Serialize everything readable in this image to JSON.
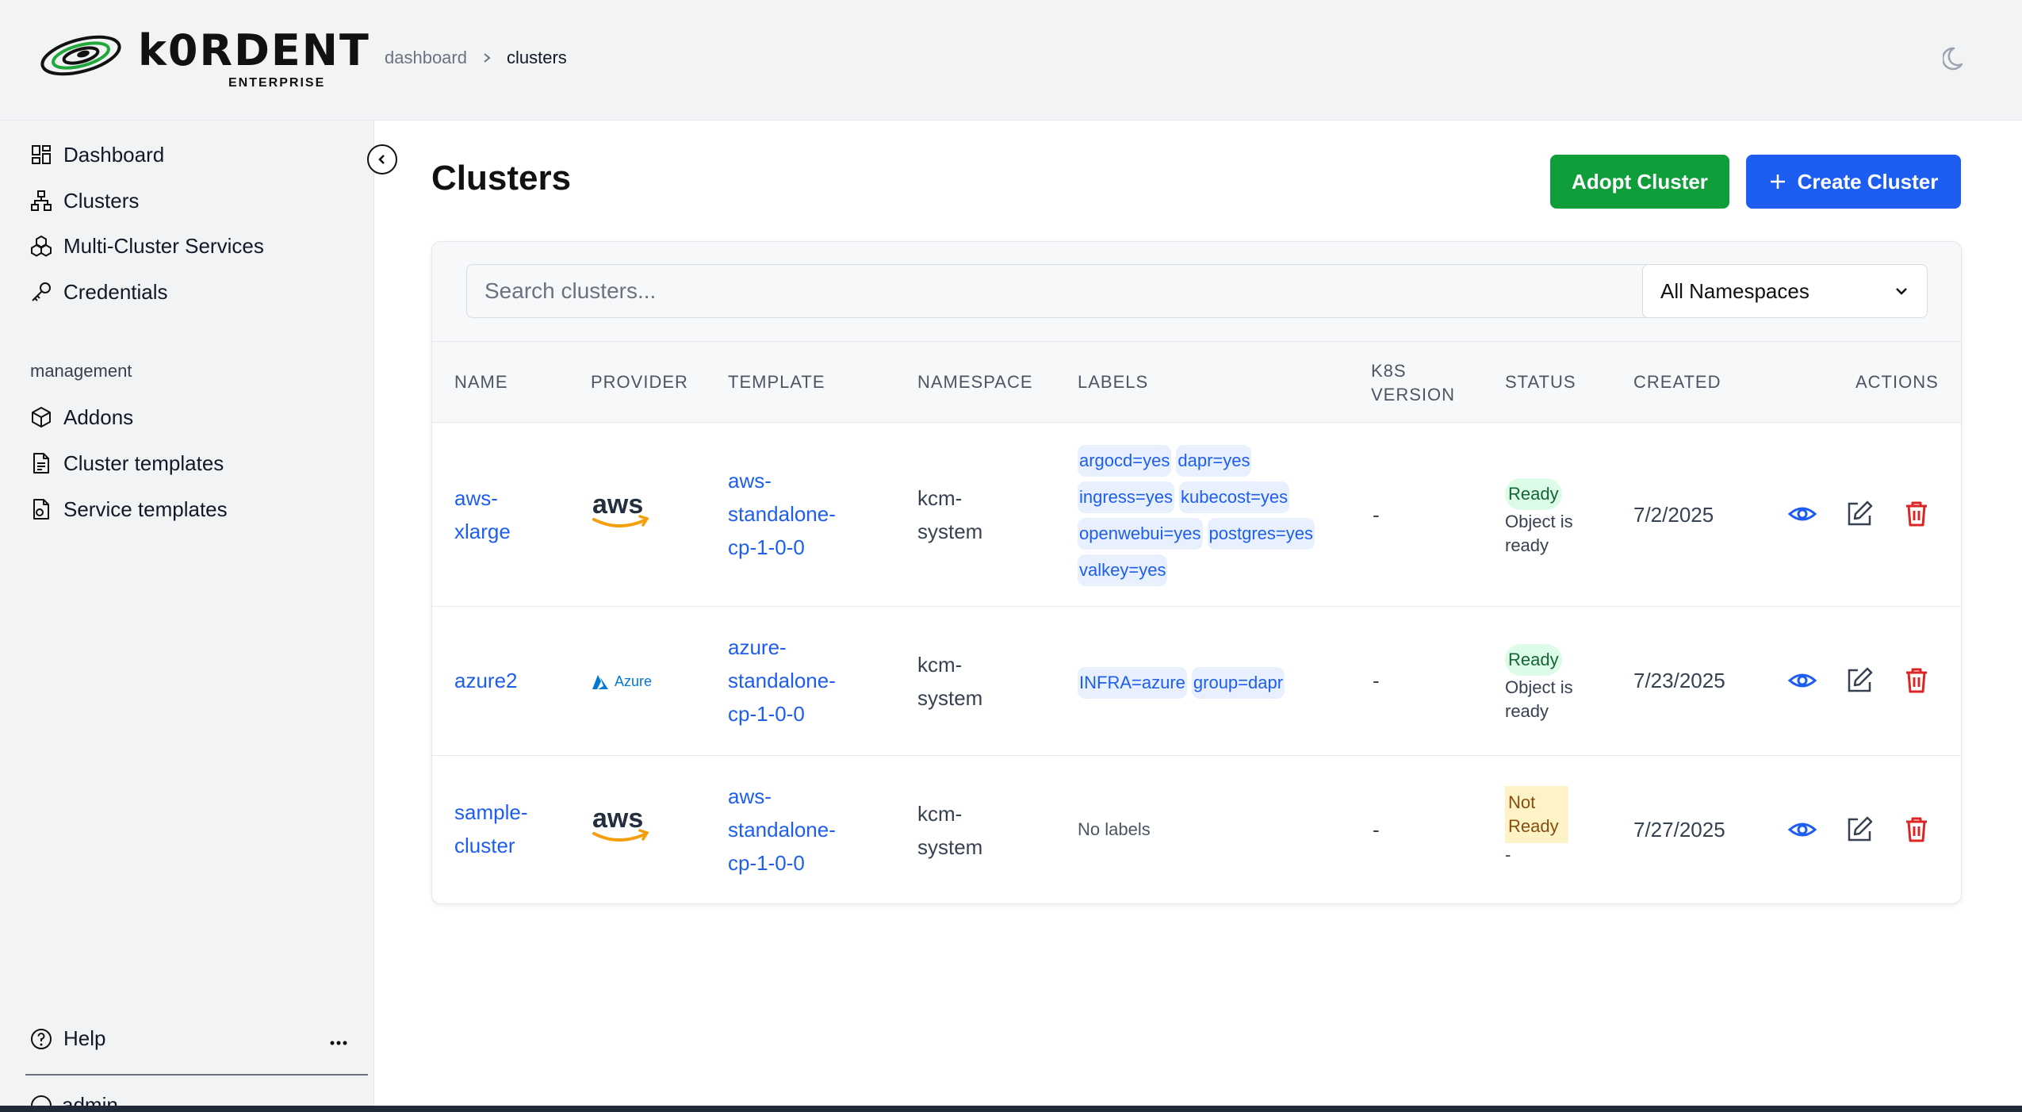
{
  "brand": {
    "name": "k0RDENT",
    "subtitle": "ENTERPRISE"
  },
  "breadcrumb": {
    "items": [
      "dashboard",
      "clusters"
    ]
  },
  "sidebar": {
    "items": [
      {
        "label": "Dashboard",
        "icon": "dashboard-icon"
      },
      {
        "label": "Clusters",
        "icon": "cluster-icon"
      },
      {
        "label": "Multi-Cluster Services",
        "icon": "services-icon"
      },
      {
        "label": "Credentials",
        "icon": "key-icon"
      }
    ],
    "section": "management",
    "management_items": [
      {
        "label": "Addons",
        "icon": "box-icon"
      },
      {
        "label": "Cluster templates",
        "icon": "file-icon"
      },
      {
        "label": "Service templates",
        "icon": "file-gear-icon"
      }
    ],
    "help": "Help",
    "user": "admin"
  },
  "page": {
    "title": "Clusters",
    "adopt_button": "Adopt Cluster",
    "create_button": "Create Cluster",
    "search_placeholder": "Search clusters...",
    "namespace_select": "All Namespaces"
  },
  "table": {
    "headers": {
      "name": "NAME",
      "provider": "PROVIDER",
      "template": "TEMPLATE",
      "namespace": "NAMESPACE",
      "labels": "LABELS",
      "k8s_version": "K8S VERSION",
      "status": "STATUS",
      "created": "CREATED",
      "actions": "ACTIONS"
    },
    "rows": [
      {
        "name": "aws-xlarge",
        "provider": "aws",
        "template": "aws-standalone-cp-1-0-0",
        "namespace": "kcm-system",
        "labels": [
          "argocd=yes",
          "dapr=yes",
          "ingress=yes",
          "kubecost=yes",
          "openwebui=yes",
          "postgres=yes",
          "valkey=yes"
        ],
        "k8s_version": "-",
        "status": "Ready",
        "status_note": "Object is ready",
        "created": "7/2/2025"
      },
      {
        "name": "azure2",
        "provider": "Azure",
        "template": "azure-standalone-cp-1-0-0",
        "namespace": "kcm-system",
        "labels": [
          "INFRA=azure",
          "group=dapr"
        ],
        "k8s_version": "-",
        "status": "Ready",
        "status_note": "Object is ready",
        "created": "7/23/2025"
      },
      {
        "name": "sample-cluster",
        "provider": "aws",
        "template": "aws-standalone-cp-1-0-0",
        "namespace": "kcm-system",
        "labels": [],
        "no_labels_text": "No labels",
        "k8s_version": "-",
        "status": "Not Ready",
        "status_note": "-",
        "created": "7/27/2025"
      }
    ]
  },
  "colors": {
    "primary": "#1d5ef0",
    "success": "#0f9e3a",
    "danger": "#dc2626",
    "aws_orange": "#f59e0b",
    "azure_blue": "#0078d4"
  }
}
